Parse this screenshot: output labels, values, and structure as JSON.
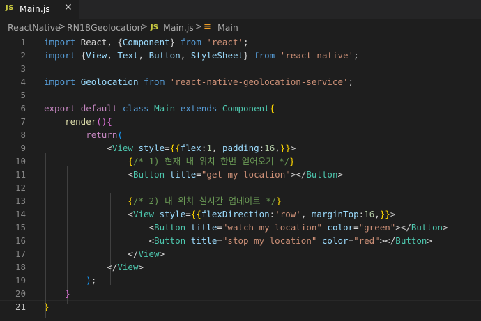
{
  "tab": {
    "icon": "JS",
    "label": "Main.js",
    "close": "✕"
  },
  "breadcrumb": {
    "items": [
      "ReactNative",
      "RN18Geolocation",
      "Main.js",
      "Main"
    ],
    "js_icon": "JS",
    "separator": ">"
  },
  "editor": {
    "lines": [
      {
        "n": "1",
        "tokens": [
          [
            "kw",
            "import "
          ],
          [
            "pun",
            "React, {"
          ],
          [
            "var",
            "Component"
          ],
          [
            "pun",
            "} "
          ],
          [
            "kw",
            "from "
          ],
          [
            "str",
            "'react'"
          ],
          [
            "pun",
            ";"
          ]
        ]
      },
      {
        "n": "2",
        "tokens": [
          [
            "kw",
            "import "
          ],
          [
            "pun",
            "{"
          ],
          [
            "var",
            "View"
          ],
          [
            "pun",
            ", "
          ],
          [
            "var",
            "Text"
          ],
          [
            "pun",
            ", "
          ],
          [
            "var",
            "Button"
          ],
          [
            "pun",
            ", "
          ],
          [
            "var",
            "StyleSheet"
          ],
          [
            "pun",
            "} "
          ],
          [
            "kw",
            "from "
          ],
          [
            "str",
            "'react-native'"
          ],
          [
            "pun",
            ";"
          ]
        ]
      },
      {
        "n": "3",
        "tokens": []
      },
      {
        "n": "4",
        "tokens": [
          [
            "kw",
            "import "
          ],
          [
            "var",
            "Geolocation "
          ],
          [
            "kw",
            "from "
          ],
          [
            "str",
            "'react-native-geolocation-service'"
          ],
          [
            "pun",
            ";"
          ]
        ]
      },
      {
        "n": "5",
        "tokens": []
      },
      {
        "n": "6",
        "tokens": [
          [
            "ctl",
            "export "
          ],
          [
            "ctl",
            "default "
          ],
          [
            "kw",
            "class "
          ],
          [
            "cls",
            "Main "
          ],
          [
            "kw",
            "extends "
          ],
          [
            "cls",
            "Component"
          ],
          [
            "brk",
            "{"
          ]
        ]
      },
      {
        "n": "7",
        "tokens": [
          [
            "pun",
            "    "
          ],
          [
            "fn",
            "render"
          ],
          [
            "brk2",
            "()"
          ],
          [
            "brk2",
            "{"
          ]
        ]
      },
      {
        "n": "8",
        "tokens": [
          [
            "pun",
            "        "
          ],
          [
            "ctl",
            "return"
          ],
          [
            "brk3",
            "("
          ]
        ]
      },
      {
        "n": "9",
        "tokens": [
          [
            "pun",
            "            "
          ],
          [
            "pun",
            "<"
          ],
          [
            "cls",
            "View "
          ],
          [
            "var",
            "style"
          ],
          [
            "pun",
            "="
          ],
          [
            "brk",
            "{{"
          ],
          [
            "var",
            "flex"
          ],
          [
            "pun",
            ":"
          ],
          [
            "num",
            "1"
          ],
          [
            "pun",
            ", "
          ],
          [
            "var",
            "padding"
          ],
          [
            "pun",
            ":"
          ],
          [
            "num",
            "16"
          ],
          [
            "pun",
            ","
          ],
          [
            "brk",
            "}}"
          ],
          [
            "pun",
            ">"
          ]
        ]
      },
      {
        "n": "10",
        "tokens": [
          [
            "pun",
            "                "
          ],
          [
            "brk",
            "{"
          ],
          [
            "com",
            "/* 1) 현재 내 위치 한번 얻어오기 */"
          ],
          [
            "brk",
            "}"
          ]
        ]
      },
      {
        "n": "11",
        "tokens": [
          [
            "pun",
            "                "
          ],
          [
            "pun",
            "<"
          ],
          [
            "cls",
            "Button "
          ],
          [
            "var",
            "title"
          ],
          [
            "pun",
            "="
          ],
          [
            "str",
            "\"get my location\""
          ],
          [
            "pun",
            "></"
          ],
          [
            "cls",
            "Button"
          ],
          [
            "pun",
            ">"
          ]
        ]
      },
      {
        "n": "12",
        "tokens": []
      },
      {
        "n": "13",
        "tokens": [
          [
            "pun",
            "                "
          ],
          [
            "brk",
            "{"
          ],
          [
            "com",
            "/* 2) 내 위치 실시간 업데이트 */"
          ],
          [
            "brk",
            "}"
          ]
        ]
      },
      {
        "n": "14",
        "tokens": [
          [
            "pun",
            "                "
          ],
          [
            "pun",
            "<"
          ],
          [
            "cls",
            "View "
          ],
          [
            "var",
            "style"
          ],
          [
            "pun",
            "="
          ],
          [
            "brk",
            "{{"
          ],
          [
            "var",
            "flexDirection"
          ],
          [
            "pun",
            ":"
          ],
          [
            "str",
            "'row'"
          ],
          [
            "pun",
            ", "
          ],
          [
            "var",
            "marginTop"
          ],
          [
            "pun",
            ":"
          ],
          [
            "num",
            "16"
          ],
          [
            "pun",
            ","
          ],
          [
            "brk",
            "}}"
          ],
          [
            "pun",
            ">"
          ]
        ]
      },
      {
        "n": "15",
        "tokens": [
          [
            "pun",
            "                    "
          ],
          [
            "pun",
            "<"
          ],
          [
            "cls",
            "Button "
          ],
          [
            "var",
            "title"
          ],
          [
            "pun",
            "="
          ],
          [
            "str",
            "\"watch my location\" "
          ],
          [
            "var",
            "color"
          ],
          [
            "pun",
            "="
          ],
          [
            "str",
            "\"green\""
          ],
          [
            "pun",
            "></"
          ],
          [
            "cls",
            "Button"
          ],
          [
            "pun",
            ">"
          ]
        ]
      },
      {
        "n": "16",
        "tokens": [
          [
            "pun",
            "                    "
          ],
          [
            "pun",
            "<"
          ],
          [
            "cls",
            "Button "
          ],
          [
            "var",
            "title"
          ],
          [
            "pun",
            "="
          ],
          [
            "str",
            "\"stop my location\" "
          ],
          [
            "var",
            "color"
          ],
          [
            "pun",
            "="
          ],
          [
            "str",
            "\"red\""
          ],
          [
            "pun",
            "></"
          ],
          [
            "cls",
            "Button"
          ],
          [
            "pun",
            ">"
          ]
        ]
      },
      {
        "n": "17",
        "tokens": [
          [
            "pun",
            "                "
          ],
          [
            "pun",
            "</"
          ],
          [
            "cls",
            "View"
          ],
          [
            "pun",
            ">"
          ]
        ]
      },
      {
        "n": "18",
        "tokens": [
          [
            "pun",
            "            "
          ],
          [
            "pun",
            "</"
          ],
          [
            "cls",
            "View"
          ],
          [
            "pun",
            ">"
          ]
        ]
      },
      {
        "n": "19",
        "tokens": [
          [
            "pun",
            "        "
          ],
          [
            "brk3",
            ")"
          ],
          [
            "pun",
            ";"
          ]
        ]
      },
      {
        "n": "20",
        "tokens": [
          [
            "pun",
            "    "
          ],
          [
            "brk2",
            "}"
          ]
        ]
      },
      {
        "n": "21",
        "tokens": [
          [
            "brk",
            "}"
          ]
        ]
      }
    ]
  }
}
